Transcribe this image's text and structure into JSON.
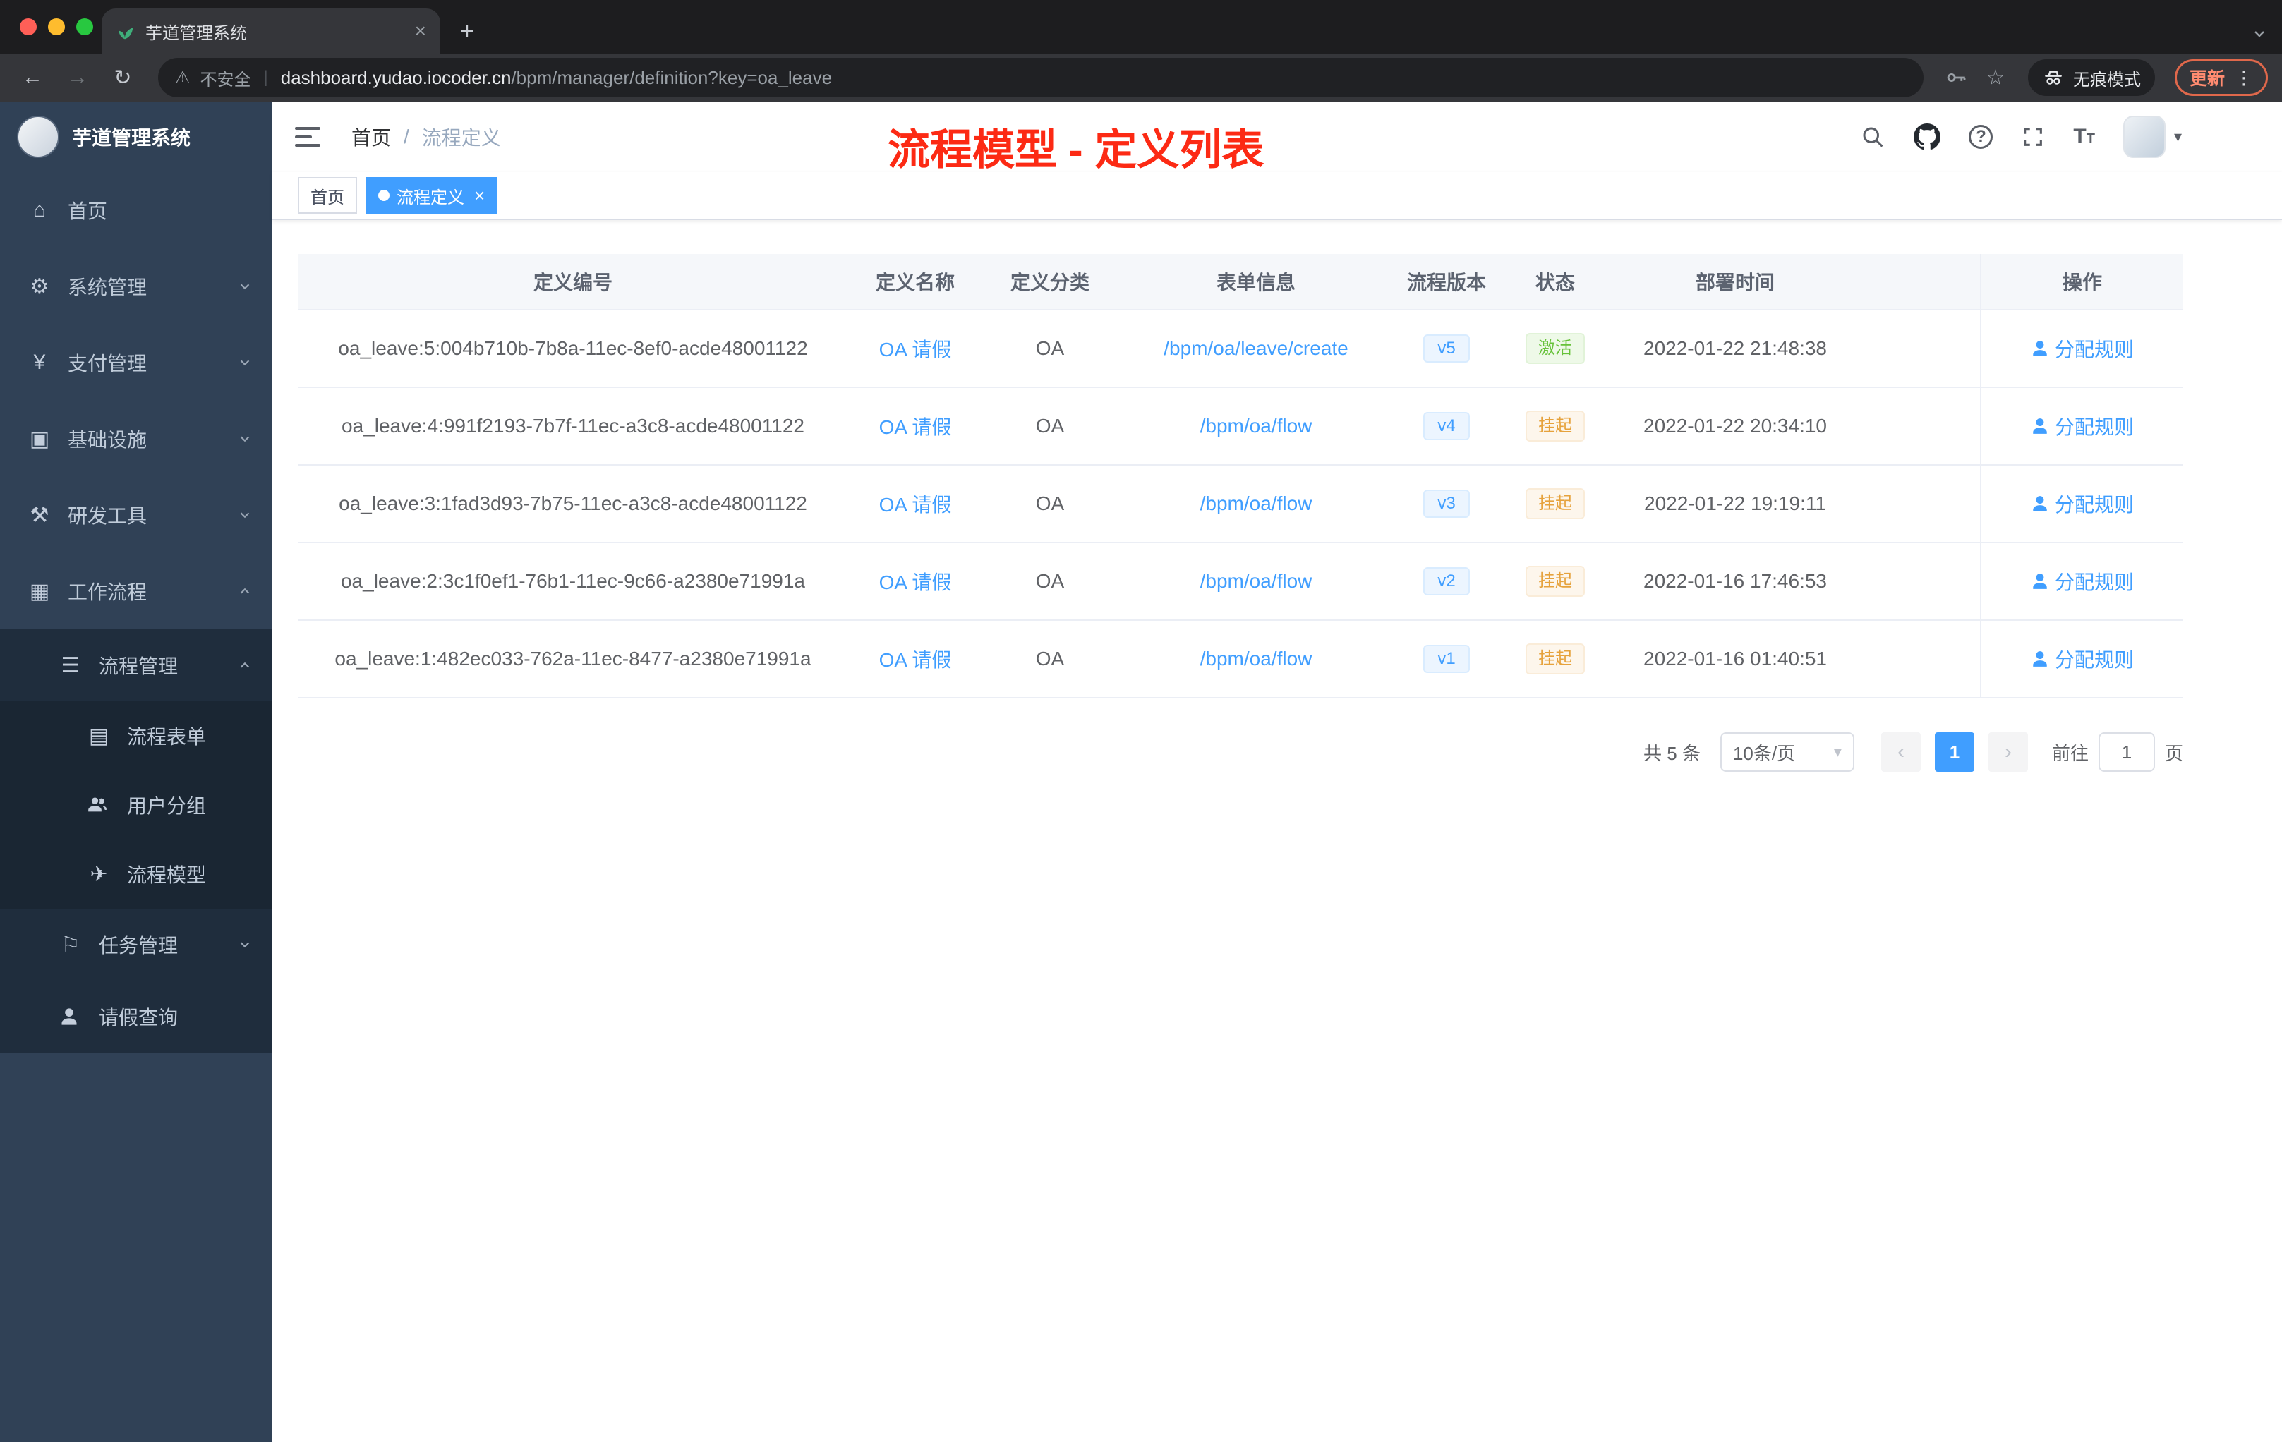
{
  "browser": {
    "tab_title": "芋道管理系统",
    "close_icon": "×",
    "new_tab_icon": "+",
    "back_icon": "←",
    "forward_icon": "→",
    "reload_icon": "↻",
    "warning_icon": "⚠",
    "security_warning": "不安全",
    "url_separator": "|",
    "url_domain": "dashboard.yudao.iocoder.cn",
    "url_path": "/bpm/manager/definition?key=oa_leave",
    "star_icon": "☆",
    "incognito_label": "无痕模式",
    "update_label": "更新",
    "menu_icon": "⋮"
  },
  "sidebar": {
    "logo_title": "芋道管理系统",
    "items": [
      {
        "label": "首页",
        "icon": "dashboard-icon",
        "glyph": "⌂"
      },
      {
        "label": "系统管理",
        "icon": "gear-icon",
        "glyph": "⚙",
        "chevron": "down"
      },
      {
        "label": "支付管理",
        "icon": "yen-icon",
        "glyph": "¥",
        "chevron": "down"
      },
      {
        "label": "基础设施",
        "icon": "infrastructure-icon",
        "glyph": "▣",
        "chevron": "down"
      },
      {
        "label": "研发工具",
        "icon": "tools-icon",
        "glyph": "⚒",
        "chevron": "down"
      },
      {
        "label": "工作流程",
        "icon": "workflow-icon",
        "glyph": "▦",
        "chevron": "up"
      },
      {
        "label": "流程管理",
        "icon": "process-list-icon",
        "glyph": "☰",
        "chevron": "up"
      },
      {
        "label": "流程表单",
        "icon": "form-icon",
        "glyph": "▤"
      },
      {
        "label": "用户分组",
        "icon": "user-group-icon",
        "glyph": ""
      },
      {
        "label": "流程模型",
        "icon": "send-icon",
        "glyph": "✈"
      },
      {
        "label": "任务管理",
        "icon": "task-flag-icon",
        "glyph": "⚐",
        "chevron": "down"
      },
      {
        "label": "请假查询",
        "icon": "person-icon",
        "glyph": ""
      }
    ]
  },
  "header": {
    "breadcrumb": {
      "home": "首页",
      "separator": "/",
      "current": "流程定义"
    },
    "annotation": "流程模型 - 定义列表"
  },
  "tags": {
    "items": [
      {
        "label": "首页"
      },
      {
        "label": "流程定义"
      }
    ],
    "close_icon": "×"
  },
  "table": {
    "columns": [
      "定义编号",
      "定义名称",
      "定义分类",
      "表单信息",
      "流程版本",
      "状态",
      "部署时间",
      "",
      "操作"
    ],
    "rows": [
      {
        "id": "oa_leave:5:004b710b-7b8a-11ec-8ef0-acde48001122",
        "name": "OA 请假",
        "category": "OA",
        "form": "/bpm/oa/leave/create",
        "version": "v5",
        "status": "激活",
        "deploy_time": "2022-01-22 21:48:38",
        "action": "分配规则"
      },
      {
        "id": "oa_leave:4:991f2193-7b7f-11ec-a3c8-acde48001122",
        "name": "OA 请假",
        "category": "OA",
        "form": "/bpm/oa/flow",
        "version": "v4",
        "status": "挂起",
        "deploy_time": "2022-01-22 20:34:10",
        "action": "分配规则"
      },
      {
        "id": "oa_leave:3:1fad3d93-7b75-11ec-a3c8-acde48001122",
        "name": "OA 请假",
        "category": "OA",
        "form": "/bpm/oa/flow",
        "version": "v3",
        "status": "挂起",
        "deploy_time": "2022-01-22 19:19:11",
        "action": "分配规则"
      },
      {
        "id": "oa_leave:2:3c1f0ef1-76b1-11ec-9c66-a2380e71991a",
        "name": "OA 请假",
        "category": "OA",
        "form": "/bpm/oa/flow",
        "version": "v2",
        "status": "挂起",
        "deploy_time": "2022-01-16 17:46:53",
        "action": "分配规则"
      },
      {
        "id": "oa_leave:1:482ec033-762a-11ec-8477-a2380e71991a",
        "name": "OA 请假",
        "category": "OA",
        "form": "/bpm/oa/flow",
        "version": "v1",
        "status": "挂起",
        "deploy_time": "2022-01-16 01:40:51",
        "action": "分配规则"
      }
    ]
  },
  "pagination": {
    "total": "共 5 条",
    "page_size": "10条/页",
    "size_caret": "▾",
    "prev_icon": "‹",
    "next_icon": "›",
    "current_page": "1",
    "goto_label": "前往",
    "goto_value": "1",
    "page_unit": "页"
  },
  "colors": {
    "primary": "#409eff",
    "success": "#67c23a",
    "warning": "#e6a23c",
    "annotation": "#fc2a14"
  }
}
